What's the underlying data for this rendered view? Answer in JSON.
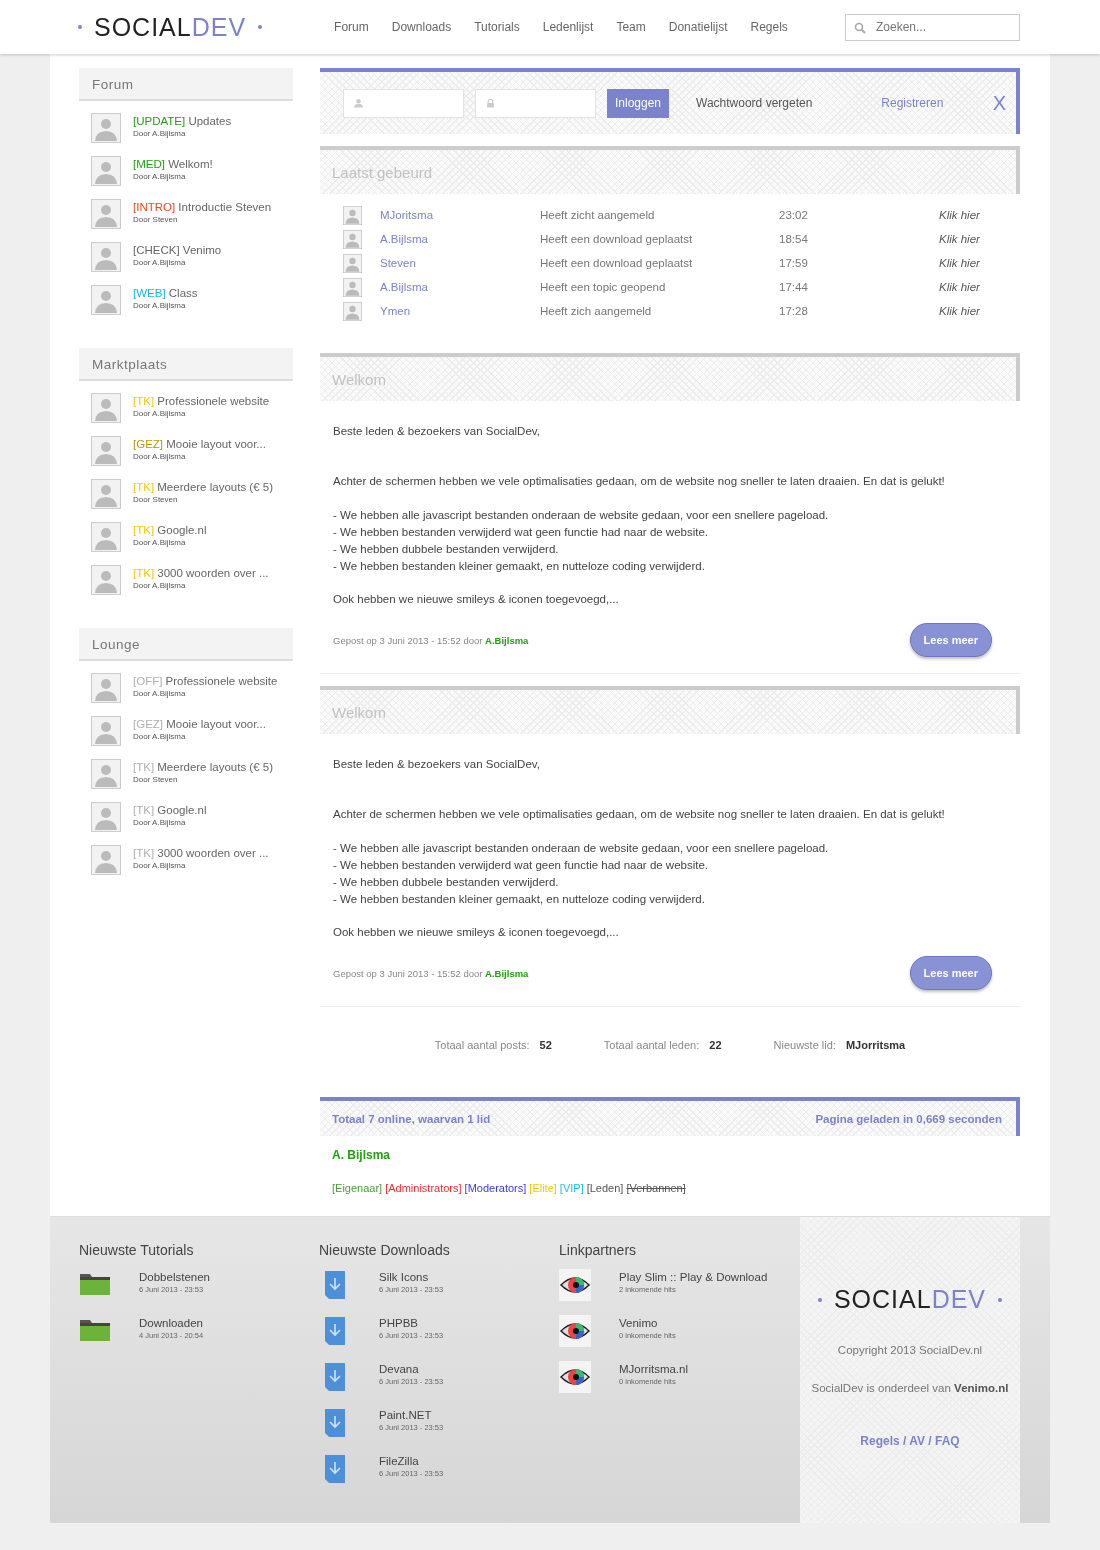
{
  "header": {
    "logo": {
      "dark": "SOCIAL",
      "accent": "DEV"
    },
    "nav": [
      {
        "label": "Forum"
      },
      {
        "label": "Downloads"
      },
      {
        "label": "Tutorials"
      },
      {
        "label": "Ledenlijst"
      },
      {
        "label": "Team"
      },
      {
        "label": "Donatielijst"
      },
      {
        "label": "Regels"
      }
    ],
    "search": {
      "placeholder": "Zoeken..."
    }
  },
  "sidebar": [
    {
      "title": "Forum",
      "topics": [
        {
          "tag": "[UPDATE]",
          "color": "#22a010",
          "title": "Updates",
          "author": "Door A.Bijlsma"
        },
        {
          "tag": "[MED]",
          "color": "#22a010",
          "title": "Welkom!",
          "author": "Door A.Bijlsma"
        },
        {
          "tag": "[INTRO]",
          "color": "#f04a14",
          "title": "Introductie Steven",
          "author": "Door Steven"
        },
        {
          "tag": "[CHECK]",
          "color": "#666666",
          "title": "Venimo",
          "author": "Door A.Bijlsma"
        },
        {
          "tag": "[WEB]",
          "color": "#1ab4f0",
          "title": "Class",
          "author": "Door A.Bijlsma"
        }
      ]
    },
    {
      "title": "Marktplaats",
      "topics": [
        {
          "tag": "[TK]",
          "color": "#f5c800",
          "title": "Professionele website",
          "author": "Door A.Bijlsma"
        },
        {
          "tag": "[GEZ]",
          "color": "#b8960a",
          "title": "Mooie layout voor...",
          "author": "Door A.Bijlsma"
        },
        {
          "tag": "[TK]",
          "color": "#f5c800",
          "title": "Meerdere layouts (€ 5)",
          "author": "Door Steven"
        },
        {
          "tag": "[TK]",
          "color": "#f5c800",
          "title": "Google.nl",
          "author": "Door A.Bijlsma"
        },
        {
          "tag": "[TK]",
          "color": "#f5c800",
          "title": "3000 woorden over ...",
          "author": "Door A.Bijlsma"
        }
      ]
    },
    {
      "title": "Lounge",
      "topics": [
        {
          "tag": "[OFF]",
          "color": "#b0b0b0",
          "title": "Professionele website",
          "author": "Door A.Bijlsma"
        },
        {
          "tag": "[GEZ]",
          "color": "#b0b0b0",
          "title": "Mooie layout voor...",
          "author": "Door A.Bijlsma"
        },
        {
          "tag": "[TK]",
          "color": "#b0b0b0",
          "title": "Meerdere layouts (€ 5)",
          "author": "Door Steven"
        },
        {
          "tag": "[TK]",
          "color": "#b0b0b0",
          "title": "Google.nl",
          "author": "Door A.Bijlsma"
        },
        {
          "tag": "[TK]",
          "color": "#b0b0b0",
          "title": "3000 woorden over ...",
          "author": "Door A.Bijlsma"
        }
      ]
    }
  ],
  "login": {
    "button": "Inloggen",
    "forgot": "Wachtwoord vergeten",
    "register": "Registreren",
    "close": "X"
  },
  "activity": {
    "title": "Laatst gebeurd",
    "rows": [
      {
        "user": "MJoritsma",
        "action": "Heeft zicht aangemeld",
        "time": "23:02",
        "link": "Klik hier"
      },
      {
        "user": "A.Bijlsma",
        "action": "Heeft een download geplaatst",
        "time": "18:54",
        "link": "Klik hier"
      },
      {
        "user": "Steven",
        "action": "Heeft een download geplaatst",
        "time": "17:59",
        "link": "Klik hier"
      },
      {
        "user": "A.Bijlsma",
        "action": "Heeft een topic geopend",
        "time": "17:44",
        "link": "Klik hier"
      },
      {
        "user": "Ymen",
        "action": "Heeft zich aangemeld",
        "time": "17:28",
        "link": "Klik hier"
      }
    ]
  },
  "posts": [
    {
      "title": "Welkom",
      "greeting": "Beste leden & bezoekers van SocialDev,",
      "intro": "Achter de schermen hebben we vele optimalisaties gedaan, om de website nog sneller te laten draaien. En dat is gelukt!",
      "lines": [
        "- We hebben alle javascript bestanden onderaan de website gedaan, voor een snellere pageload.",
        "- We hebben bestanden verwijderd wat geen functie had naar de website.",
        "- We hebben dubbele bestanden verwijderd.",
        "- We hebben bestanden kleiner gemaakt, en nutteloze coding verwijderd."
      ],
      "closing": "Ook hebben we nieuwe smileys & iconen toegevoegd,...",
      "meta": "Gepost op 3 Juni 2013 - 15:52 door **A.Bijlsma**",
      "button": "Lees meer"
    },
    {
      "title": "Welkom",
      "greeting": "Beste leden & bezoekers van SocialDev,",
      "intro": "Achter de schermen hebben we vele optimalisaties gedaan, om de website nog sneller te laten draaien. En dat is gelukt!",
      "lines": [
        "- We hebben alle javascript bestanden onderaan de website gedaan, voor een snellere pageload.",
        "- We hebben bestanden verwijderd wat geen functie had naar de website.",
        "- We hebben dubbele bestanden verwijderd.",
        "- We hebben bestanden kleiner gemaakt, en nutteloze coding verwijderd."
      ],
      "closing": "Ook hebben we nieuwe smileys & iconen toegevoegd,...",
      "meta": "Gepost op 3 Juni 2013 - 15:52 door **A.Bijlsma**",
      "button": "Lees meer"
    }
  ],
  "stats": [
    {
      "label": "Totaal aantal posts:",
      "value": "52"
    },
    {
      "label": "Totaal aantal leden:",
      "value": "22"
    },
    {
      "label": "Nieuwste lid:",
      "value": "MJorritsma"
    }
  ],
  "online": {
    "summary": "Totaal 7 online, waarvan 1 lid",
    "load_time": "Pagina geladen in 0,669 seconden",
    "user": "A. Bijlsma",
    "roles": [
      {
        "label": "[Eigenaar]",
        "color": "#4a9a3a",
        "struck": false
      },
      {
        "label": "[Administrators]",
        "color": "#f03030",
        "struck": false
      },
      {
        "label": "[Moderators]",
        "color": "#3a3af0",
        "struck": false
      },
      {
        "label": "[Elite]",
        "color": "#f5c800",
        "struck": false
      },
      {
        "label": "[VIP]",
        "color": "#1ac0f0",
        "struck": false
      },
      {
        "label": "[Leden]",
        "color": "#555555",
        "struck": false
      },
      {
        "label": "[Verbannen]",
        "color": "#555555",
        "struck": true
      }
    ]
  },
  "footer": {
    "columns": [
      {
        "kind": "folder",
        "title": "Nieuwste Tutorials",
        "items": [
          {
            "name": "Dobbelstenen",
            "meta": "6 Juni 2013 - 23:53"
          },
          {
            "name": "Downloaden",
            "meta": "4 Juni 2013 - 20:54"
          }
        ]
      },
      {
        "kind": "download",
        "title": "Nieuwste Downloads",
        "items": [
          {
            "name": "Silk Icons",
            "meta": "6 Juni 2013 - 23:53"
          },
          {
            "name": "PHPBB",
            "meta": "6 Juni 2013 - 23:53"
          },
          {
            "name": "Devana",
            "meta": "6 Juni 2013 - 23:53"
          },
          {
            "name": "Paint.NET",
            "meta": "6 Juni 2013 - 23:53"
          },
          {
            "name": "FileZilla",
            "meta": "6 Juni 2013 - 23:53"
          }
        ]
      },
      {
        "kind": "partner",
        "title": "Linkpartners",
        "items": [
          {
            "name": "Play Slim :: Play & Download",
            "meta": "2 inkomende hits"
          },
          {
            "name": "Venimo",
            "meta": "0 inkomende hits"
          },
          {
            "name": "MJorritsma.nl",
            "meta": "0 inkomende hits"
          }
        ]
      }
    ],
    "logo": {
      "dark": "SOCIAL",
      "accent": "DEV"
    },
    "copyright": "Copyright 2013 SocialDev.nl",
    "owner": "SocialDev is onderdeel van **Venimo.nl**",
    "links": "Regels / AV / FAQ"
  }
}
